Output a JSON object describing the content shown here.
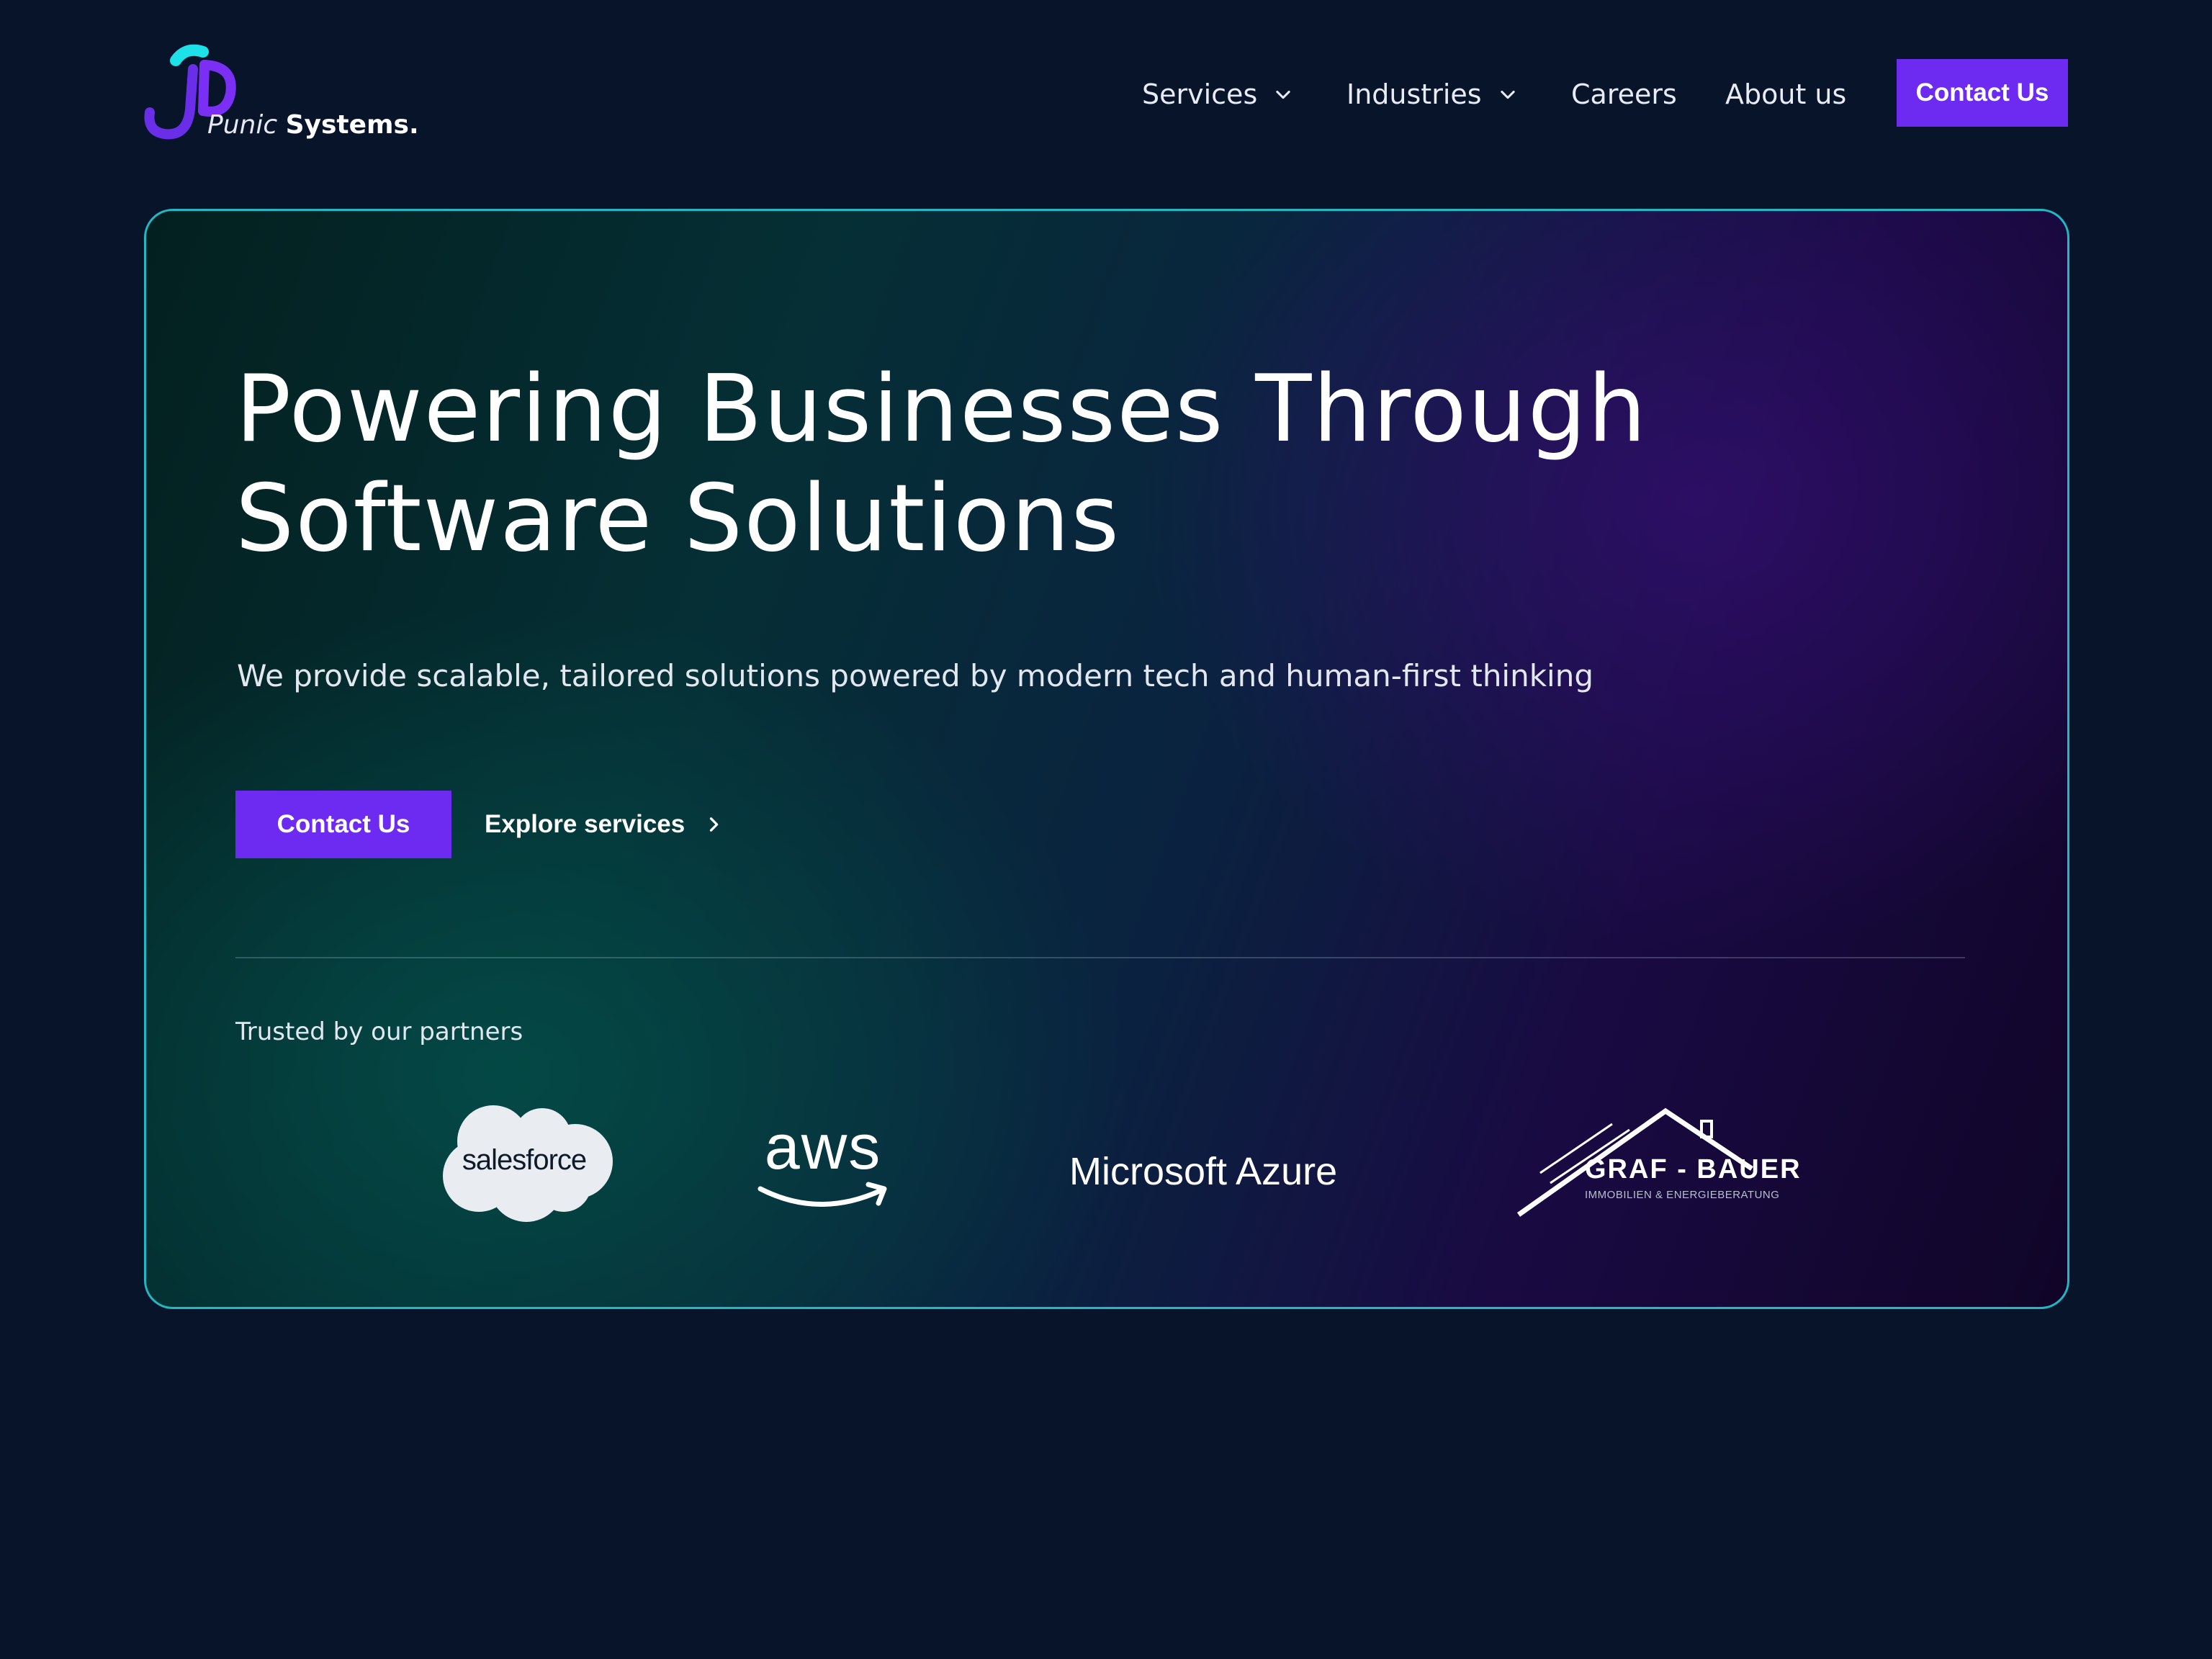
{
  "brand": {
    "name_regular": "Punic",
    "name_bold": "Systems.",
    "colors": {
      "accent": "#6d2bf2",
      "teal": "#1fb8c3",
      "background": "#08142a"
    }
  },
  "nav": {
    "items": [
      {
        "label": "Services",
        "has_dropdown": true,
        "icon": "chevron-down-icon"
      },
      {
        "label": "Industries",
        "has_dropdown": true,
        "icon": "chevron-down-icon"
      },
      {
        "label": "Careers",
        "has_dropdown": false
      },
      {
        "label": "About us",
        "has_dropdown": false
      }
    ],
    "cta_label": "Contact Us"
  },
  "hero": {
    "title_line1": "Powering Businesses Through",
    "title_line2": "Software Solutions",
    "subtitle": "We provide scalable, tailored solutions powered by modern tech and human-first thinking",
    "primary_cta": "Contact Us",
    "secondary_cta": "Explore services",
    "secondary_icon": "chevron-right-icon"
  },
  "partners": {
    "label": "Trusted by our partners",
    "logos": [
      {
        "name": "salesforce",
        "text": "salesforce"
      },
      {
        "name": "aws",
        "text": "aws"
      },
      {
        "name": "microsoft-azure",
        "text": "Microsoft Azure"
      },
      {
        "name": "graf-bauer",
        "text": "GRAF - BAUER",
        "subtext": "IMMOBILIEN & ENERGIEBERATUNG"
      }
    ]
  }
}
